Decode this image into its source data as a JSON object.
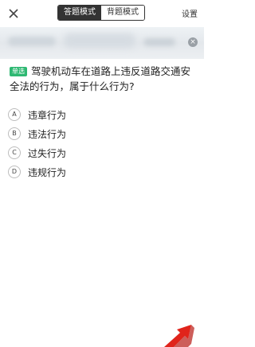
{
  "header": {
    "mode_answer": "答题模式",
    "mode_memorize": "背题模式",
    "settings": "设置"
  },
  "question": {
    "type_badge": "单选",
    "text": "驾驶机动车在道路上违反道路交通安全法的行为，属于什么行为?"
  },
  "options": [
    {
      "letter": "A",
      "text": "违章行为"
    },
    {
      "letter": "B",
      "text": "违法行为"
    },
    {
      "letter": "C",
      "text": "过失行为"
    },
    {
      "letter": "D",
      "text": "违规行为"
    }
  ],
  "icons": {
    "back": "close-icon",
    "banner_close": "close-icon"
  },
  "colors": {
    "badge": "#2eb872",
    "active_tab": "#333333",
    "annotation_arrow": "#e0241b"
  }
}
